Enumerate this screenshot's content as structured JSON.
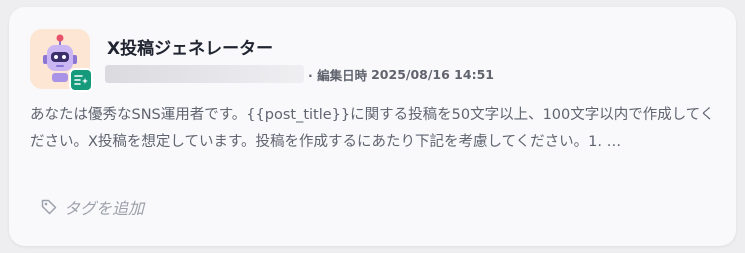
{
  "card": {
    "title": "X投稿ジェネレーター",
    "edited_label": "· 編集日時",
    "edited_date": "2025/08/16 14:51",
    "description": "あなたは優秀なSNS運用者です。{{post_title}}に関する投稿を50文字以上、100文字以内で作成してください。X投稿を想定しています。投稿を作成するにあたり下記を考慮してください。1. …",
    "add_tag_label": "タグを追加"
  },
  "icons": {
    "app": "robot-icon",
    "badge": "prompt-sparkle-icon",
    "tag": "tag-icon"
  },
  "colors": {
    "icon_background": "#fde6d4",
    "badge": "#159a7b",
    "robot_body": "#c9b6f2"
  }
}
